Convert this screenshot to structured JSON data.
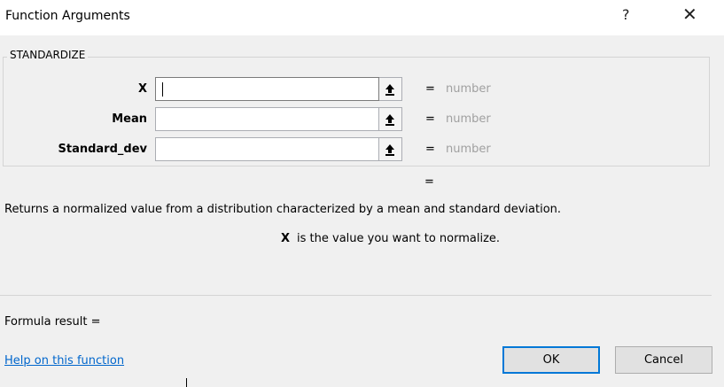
{
  "dialog": {
    "title": "Function Arguments",
    "help_glyph": "?",
    "close_glyph": "✕"
  },
  "function_name": "STANDARDIZE",
  "arguments": [
    {
      "name": "X",
      "value": "",
      "equals": "=",
      "result": "number"
    },
    {
      "name": "Mean",
      "value": "",
      "equals": "=",
      "result": "number"
    },
    {
      "name": "Standard_dev",
      "value": "",
      "equals": "=",
      "result": "number"
    }
  ],
  "function_result_equals": "=",
  "description": "Returns a normalized value from a distribution characterized by a mean and standard deviation.",
  "argument_help": {
    "name": "X",
    "text": "is the value you want to normalize."
  },
  "formula_result_label": "Formula result =",
  "help_link": "Help on this function",
  "buttons": {
    "ok": "OK",
    "cancel": "Cancel"
  },
  "colors": {
    "accent": "#0078d7",
    "link": "#0066cc",
    "placeholder_value": "#a0a0a0"
  }
}
